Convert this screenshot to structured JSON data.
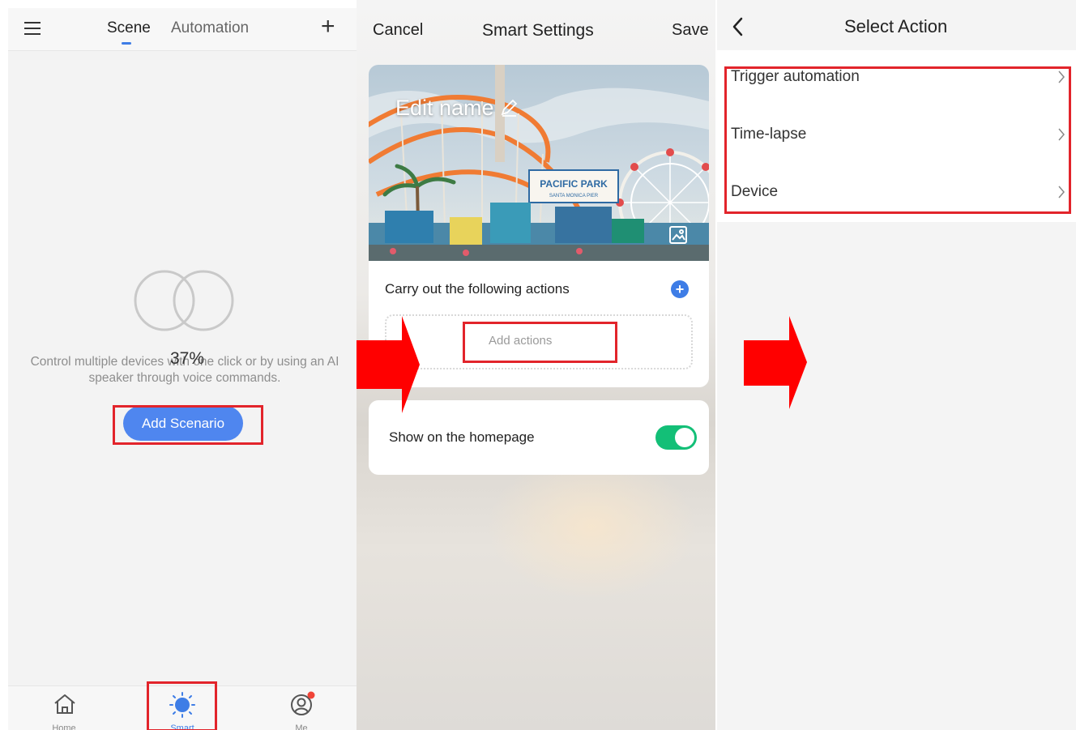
{
  "panel1": {
    "tabs": [
      {
        "label": "Scene",
        "active": true
      },
      {
        "label": "Automation",
        "active": false
      }
    ],
    "add_symbol": "+",
    "empty_description": "Control multiple devices with one click or by using an AI speaker through voice commands.",
    "loading_percent": "37%",
    "add_scenario_label": "Add Scenario",
    "nav": [
      {
        "label": "Home",
        "icon": "home-icon"
      },
      {
        "label": "Smart",
        "icon": "sun-icon",
        "active": true
      },
      {
        "label": "Me",
        "icon": "profile-icon",
        "badge": true
      }
    ]
  },
  "panel2": {
    "cancel_label": "Cancel",
    "title": "Smart Settings",
    "save_label": "Save",
    "edit_name_label": "Edit name",
    "hero_sign": "PACIFIC PARK",
    "hero_subsign": "SANTA MONICA PIER",
    "carry_out_label": "Carry out the following actions",
    "add_actions_label": "Add actions",
    "show_homepage_label": "Show on the homepage",
    "show_homepage_on": true
  },
  "panel3": {
    "title": "Select Action",
    "items": [
      {
        "label": "Trigger automation"
      },
      {
        "label": "Time-lapse"
      },
      {
        "label": "Device"
      }
    ]
  },
  "colors": {
    "accent_blue": "#4f86ef",
    "toggle_green": "#13bf77",
    "highlight_red": "#e2242b",
    "arrow_red": "#ff0000"
  }
}
